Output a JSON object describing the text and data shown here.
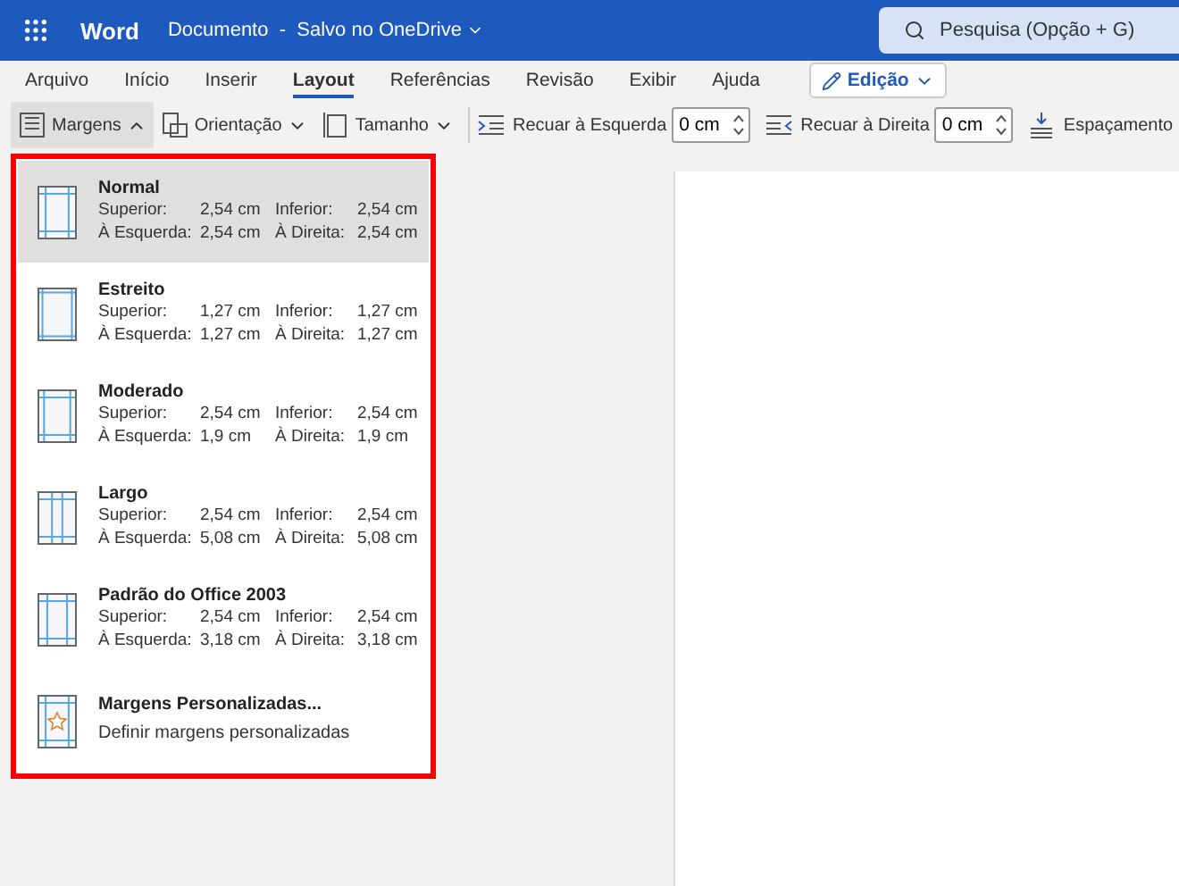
{
  "app": {
    "name": "Word",
    "document_status": "Documento  -  Salvo no OneDrive"
  },
  "search": {
    "placeholder": "Pesquisa (Opção + G)"
  },
  "tabs": [
    {
      "label": "Arquivo",
      "selected": false
    },
    {
      "label": "Início",
      "selected": false
    },
    {
      "label": "Inserir",
      "selected": false
    },
    {
      "label": "Layout",
      "selected": true
    },
    {
      "label": "Referências",
      "selected": false
    },
    {
      "label": "Revisão",
      "selected": false
    },
    {
      "label": "Exibir",
      "selected": false
    },
    {
      "label": "Ajuda",
      "selected": false
    }
  ],
  "mode_button": "Edição",
  "toolbar": {
    "margins": {
      "label": "Margens",
      "expanded": true
    },
    "orientation": "Orientação",
    "size": "Tamanho",
    "indent_left": {
      "label": "Recuar à Esquerda",
      "value": "0 cm"
    },
    "indent_right": {
      "label": "Recuar à Direita",
      "value": "0 cm"
    },
    "spacing": "Espaçamento"
  },
  "margins_menu": [
    {
      "kind": "preset",
      "name": "Normal",
      "selected": true,
      "top_label": "Superior:",
      "top": "2,54 cm",
      "bottom_label": "Inferior:",
      "bottom": "2,54 cm",
      "left_label": "À Esquerda:",
      "left": "2,54 cm",
      "right_label": "À Direita:",
      "right": "2,54 cm"
    },
    {
      "kind": "preset",
      "name": "Estreito",
      "selected": false,
      "top_label": "Superior:",
      "top": "1,27 cm",
      "bottom_label": "Inferior:",
      "bottom": "1,27 cm",
      "left_label": "À Esquerda:",
      "left": "1,27 cm",
      "right_label": "À Direita:",
      "right": "1,27 cm"
    },
    {
      "kind": "preset",
      "name": "Moderado",
      "selected": false,
      "top_label": "Superior:",
      "top": "2,54 cm",
      "bottom_label": "Inferior:",
      "bottom": "2,54 cm",
      "left_label": "À Esquerda:",
      "left": "1,9 cm",
      "right_label": "À Direita:",
      "right": "1,9 cm"
    },
    {
      "kind": "preset",
      "name": "Largo",
      "selected": false,
      "top_label": "Superior:",
      "top": "2,54 cm",
      "bottom_label": "Inferior:",
      "bottom": "2,54 cm",
      "left_label": "À Esquerda:",
      "left": "5,08 cm",
      "right_label": "À Direita:",
      "right": "5,08 cm"
    },
    {
      "kind": "preset",
      "name": "Padrão do Office 2003",
      "selected": false,
      "top_label": "Superior:",
      "top": "2,54 cm",
      "bottom_label": "Inferior:",
      "bottom": "2,54 cm",
      "left_label": "À Esquerda:",
      "left": "3,18 cm",
      "right_label": "À Direita:",
      "right": "3,18 cm"
    },
    {
      "kind": "custom",
      "name": "Margens Personalizadas...",
      "selected": false,
      "description": "Definir margens personalizadas"
    }
  ]
}
